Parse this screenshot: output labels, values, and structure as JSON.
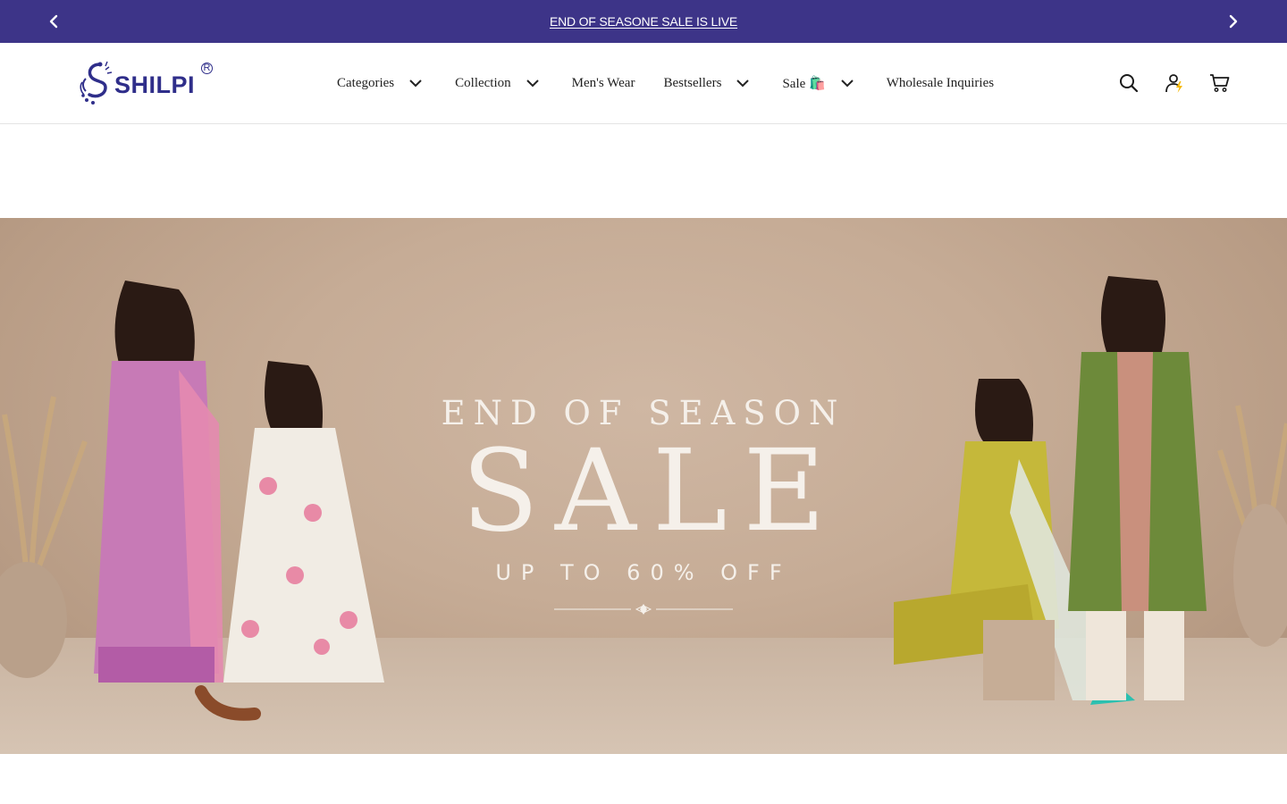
{
  "announcement": {
    "text": "END OF SEASONE SALE IS LIVE"
  },
  "brand": {
    "name": "SHILPI",
    "registered": "R",
    "color": "#2f2e8a"
  },
  "nav": {
    "items": [
      {
        "label": "Categories",
        "has_dropdown": true
      },
      {
        "label": "Collection",
        "has_dropdown": true
      },
      {
        "label": "Men's Wear",
        "has_dropdown": false
      },
      {
        "label": "Bestsellers",
        "has_dropdown": true
      },
      {
        "label": "Sale 🛍️",
        "has_dropdown": true
      },
      {
        "label": "Wholesale Inquiries",
        "has_dropdown": false
      }
    ]
  },
  "header_icons": [
    "search-icon",
    "account-icon",
    "cart-icon"
  ],
  "hero": {
    "kicker": "END OF SEASON",
    "title": "SALE",
    "subtitle": "UP TO 60% OFF"
  },
  "colors": {
    "announcement_bg": "#3d3488",
    "hero_bg": "#c6ac96",
    "accent_yellow": "#f5b800"
  }
}
